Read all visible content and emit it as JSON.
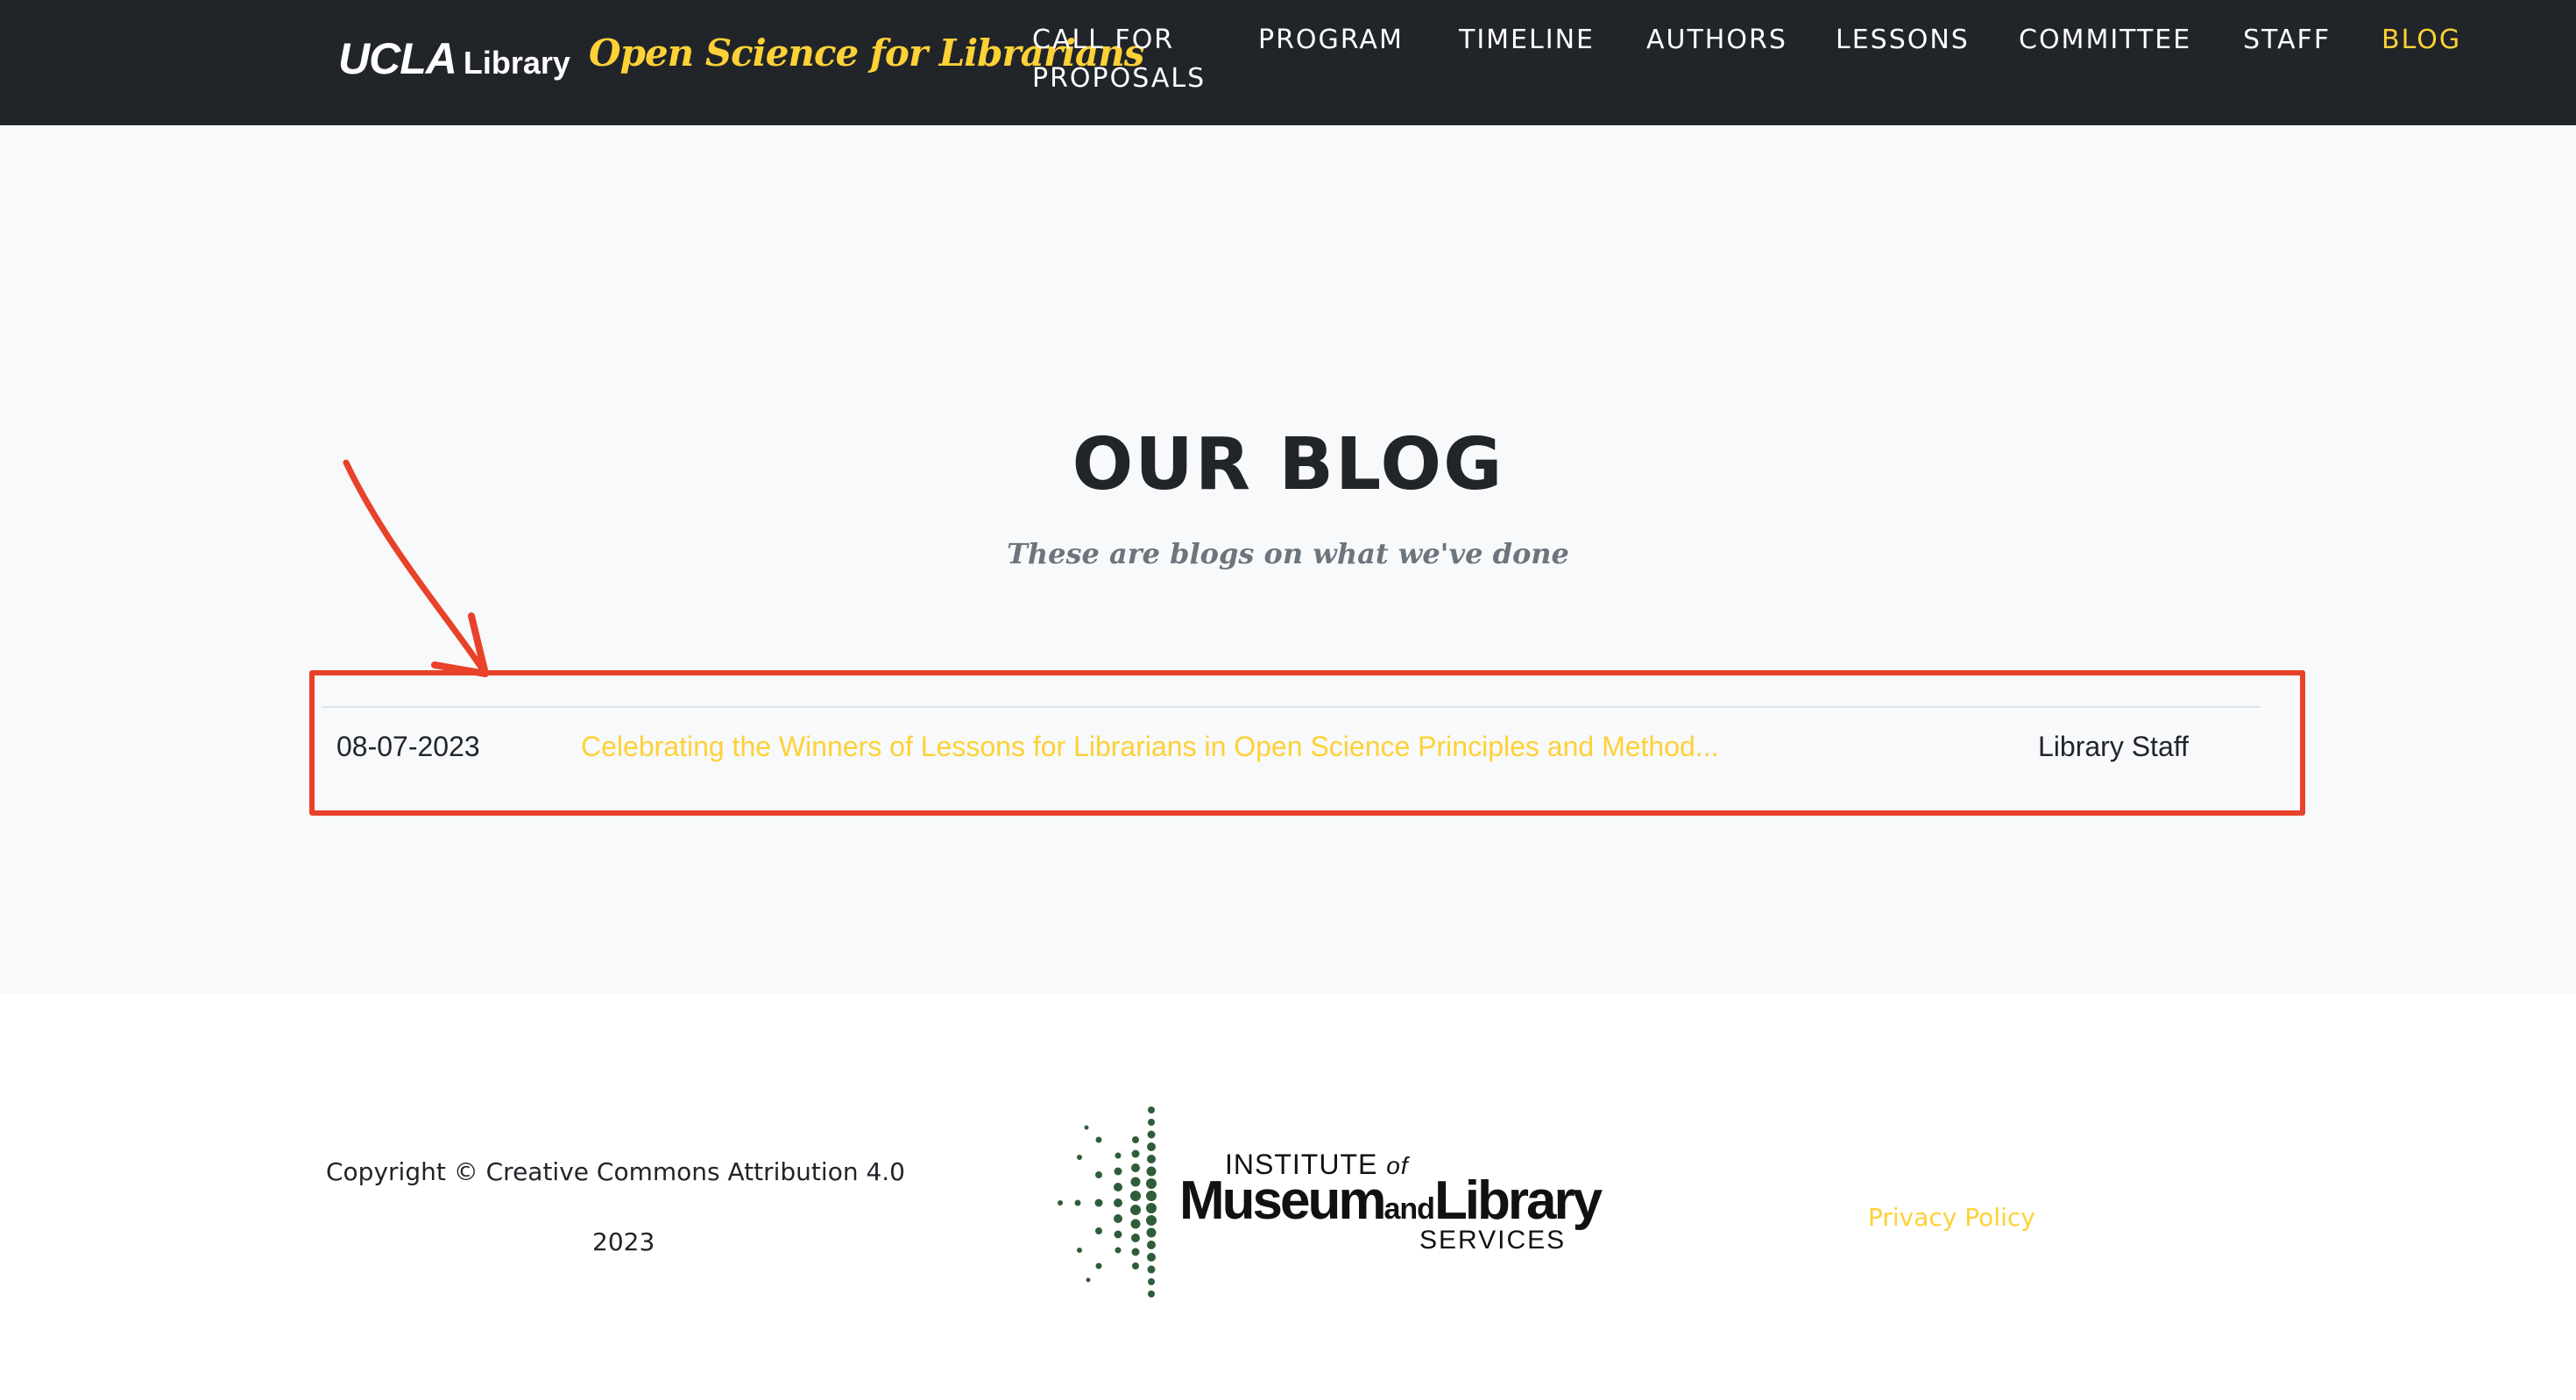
{
  "navbar": {
    "brand": {
      "ucla": "UCLA",
      "library": "Library",
      "title": "Open Science for Librarians"
    },
    "links": [
      {
        "label": "CALL FOR PROPOSALS"
      },
      {
        "label": "PROGRAM"
      },
      {
        "label": "TIMELINE"
      },
      {
        "label": "AUTHORS"
      },
      {
        "label": "LESSONS"
      },
      {
        "label": "COMMITTEE"
      },
      {
        "label": "STAFF"
      },
      {
        "label": "BLOG",
        "active": true
      }
    ]
  },
  "blog": {
    "heading": "OUR BLOG",
    "subheading": "These are blogs on what we've done",
    "posts": [
      {
        "date": "08-07-2023",
        "title": "Celebrating the Winners of Lessons for Librarians in Open Science Principles and Method...",
        "author": "Library Staff"
      }
    ]
  },
  "footer": {
    "copyright": "Copyright © Creative Commons Attribution 4.0",
    "year": "2023",
    "logo": {
      "institute": "INSTITUTE",
      "of": "of",
      "museum": "Museum",
      "and": "and",
      "library": "Library",
      "services": "SERVICES"
    },
    "privacy": "Privacy Policy"
  },
  "colors": {
    "navbar_bg": "#212529",
    "accent": "#fed136",
    "section_bg": "#f8f9fa",
    "annotation": "#e8422a",
    "logo_green": "#2f5d3a"
  },
  "icons": {
    "annotation": "arrow-annotation-icon",
    "logo": "imls-starburst-icon"
  }
}
